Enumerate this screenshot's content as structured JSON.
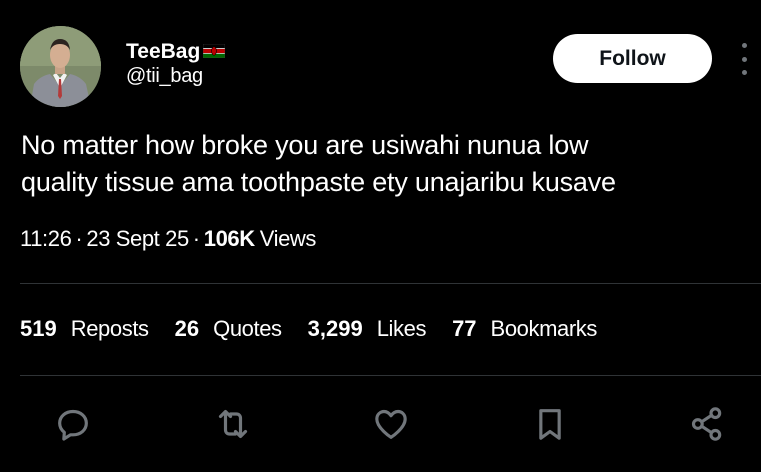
{
  "author": {
    "display_name": "TeeBag",
    "handle": "@tii_bag",
    "flag_icon": "kenya-flag-icon"
  },
  "follow_label": "Follow",
  "tweet": {
    "line1": "No matter how broke you are usiwahi nunua low",
    "line2": "quality tissue ama toothpaste ety unajaribu kusave"
  },
  "meta": {
    "time": "11:26",
    "sep": "·",
    "date": "23 Sept 25",
    "views_count": "106K",
    "views_label": "Views"
  },
  "stats": [
    {
      "count": "519",
      "label": "Reposts"
    },
    {
      "count": "26",
      "label": "Quotes"
    },
    {
      "count": "3,299",
      "label": "Likes"
    },
    {
      "count": "77",
      "label": "Bookmarks"
    }
  ],
  "actions": [
    "reply-icon",
    "repost-icon",
    "like-icon",
    "bookmark-icon",
    "share-icon"
  ],
  "colors": {
    "background": "#000000",
    "text": "#ffffff",
    "icon": "#71767b",
    "divider": "#2f3336",
    "follow_bg": "#ffffff"
  }
}
